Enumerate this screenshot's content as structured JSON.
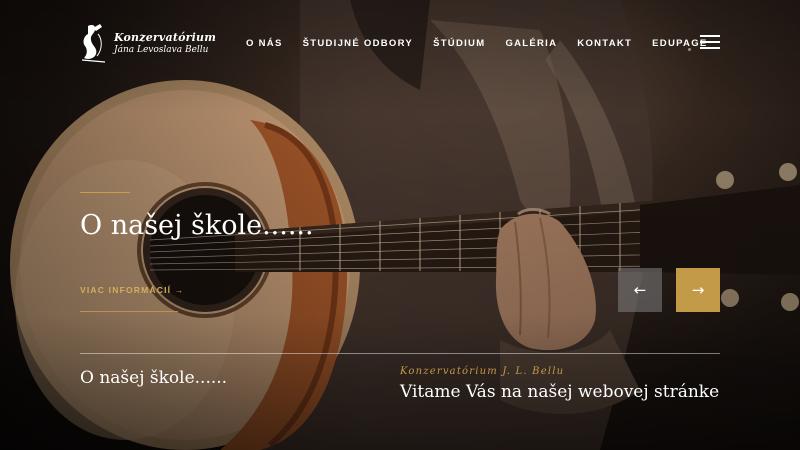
{
  "logo": {
    "line1": "Konzervatórium",
    "line2": "Jána Levoslava Bellu",
    "icon": "harpist-logo-icon"
  },
  "nav": {
    "items": [
      "O NÁS",
      "ŠTUDIJNÉ ODBORY",
      "ŠTÚDIUM",
      "GALÉRIA",
      "KONTAKT",
      "EDUPAGE"
    ],
    "menu_icon": "hamburger-menu-icon"
  },
  "hero": {
    "title": "O našej škole......",
    "more_link": "VIAC INFORMÁCIÍ →",
    "prev_arrow": "←",
    "next_arrow": "→"
  },
  "bottom": {
    "left_title": "O našej škole......",
    "right_subtitle": "Konzervatórium J. L. Bellu",
    "right_title": "Vitame Vás na našej webovej stránke"
  },
  "colors": {
    "accent_gold": "#c39a47",
    "text_white": "#ffffff",
    "arrow_prev_bg": "#8a8a8a"
  }
}
